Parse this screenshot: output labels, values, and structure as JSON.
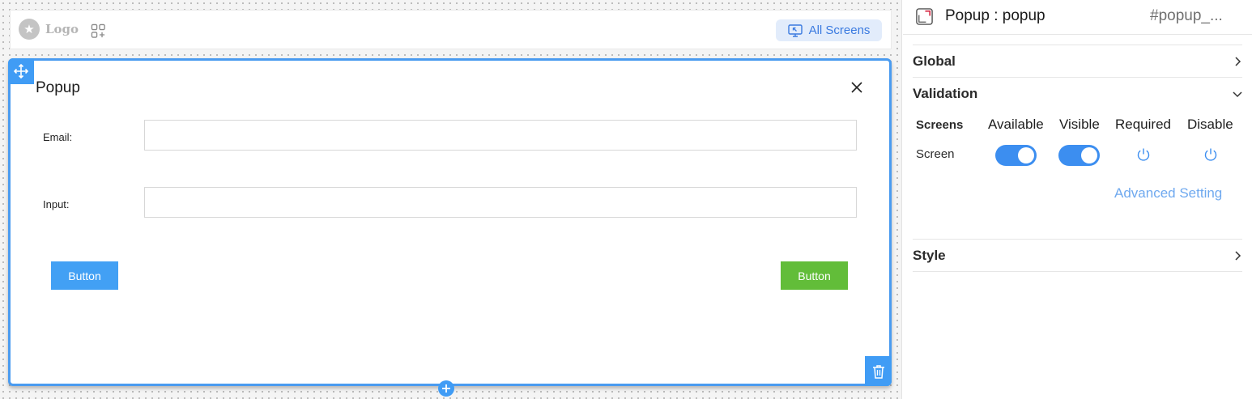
{
  "canvas": {
    "logo_text": "Logo",
    "all_screens_label": "All Screens",
    "popup": {
      "title": "Popup",
      "fields": [
        {
          "label": "Email:",
          "value": ""
        },
        {
          "label": "Input:",
          "value": ""
        }
      ],
      "left_button_label": "Button",
      "right_button_label": "Button"
    }
  },
  "panel": {
    "title": "Popup : popup",
    "id": "#popup_...",
    "sections": {
      "global": "Global",
      "validation": "Validation",
      "style": "Style"
    },
    "validation": {
      "headers": {
        "screens": "Screens",
        "available": "Available",
        "visible": "Visible",
        "required": "Required",
        "disable": "Disable"
      },
      "row": {
        "label": "Screen",
        "available": true,
        "visible": true,
        "required": false,
        "disable": false
      },
      "advanced_link": "Advanced Setting"
    }
  },
  "colors": {
    "accent": "#409cf5",
    "green": "#62bd39",
    "link": "#6fa9ef",
    "pill_bg": "#e2ecfb"
  },
  "icons": [
    "star-icon",
    "apps-icon",
    "screen-icon",
    "move-icon",
    "close-icon",
    "trash-icon",
    "plus-icon",
    "popup-icon",
    "chevron-right-icon",
    "chevron-down-icon",
    "power-icon"
  ]
}
